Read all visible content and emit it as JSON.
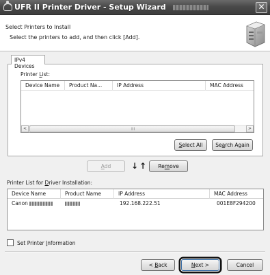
{
  "window": {
    "title": "UFR II Printer Driver - Setup Wizard",
    "title_version_redacted": true,
    "close_glyph": "✕"
  },
  "header": {
    "title": "Select Printers to Install",
    "subtitle": "Select the printers to add, and then click [Add]."
  },
  "tabs": [
    {
      "label": "IPv4 Devices",
      "selected": true
    }
  ],
  "printer_list": {
    "label_pre": "Printer ",
    "label_access": "L",
    "label_post": "ist:",
    "columns": [
      "Device Name",
      "Product Na...",
      "IP Address",
      "MAC Address"
    ],
    "rows": []
  },
  "buttons": {
    "select_all": {
      "pre": "",
      "access": "S",
      "post": "elect All"
    },
    "search_again": {
      "pre": "Se",
      "access": "a",
      "post": "rch Again"
    },
    "add": {
      "pre": "",
      "access": "A",
      "post": "dd",
      "enabled": false
    },
    "remove": {
      "pre": "Re",
      "access": "m",
      "post": "ove"
    },
    "back": {
      "pre": "< ",
      "access": "B",
      "post": "ack"
    },
    "next": {
      "pre": "",
      "access": "N",
      "post": "ext >",
      "highlighted": true
    },
    "cancel": "Cancel"
  },
  "move_arrows": "↓↑",
  "install_list": {
    "label_pre": "Printer List for ",
    "label_access": "D",
    "label_post": "river Installation:",
    "columns": [
      "Device Name",
      "Product Name",
      "IP Address",
      "MAC Address"
    ],
    "rows": [
      {
        "device_name": "Canon",
        "product_name": "",
        "ip_address": "192.168.222.51",
        "mac_address": "001E8F294200"
      }
    ]
  },
  "set_printer_info": {
    "pre": "Set Printer ",
    "access": "I",
    "post": "nformation",
    "checked": false
  },
  "scrollbar": {
    "left_glyph": "<",
    "right_glyph": ">",
    "grip_glyph": "III"
  },
  "colors": {
    "titlebar": "#4a4a4a",
    "dialog_bg": "#f0f0f0",
    "highlight_ring": "#111111"
  }
}
